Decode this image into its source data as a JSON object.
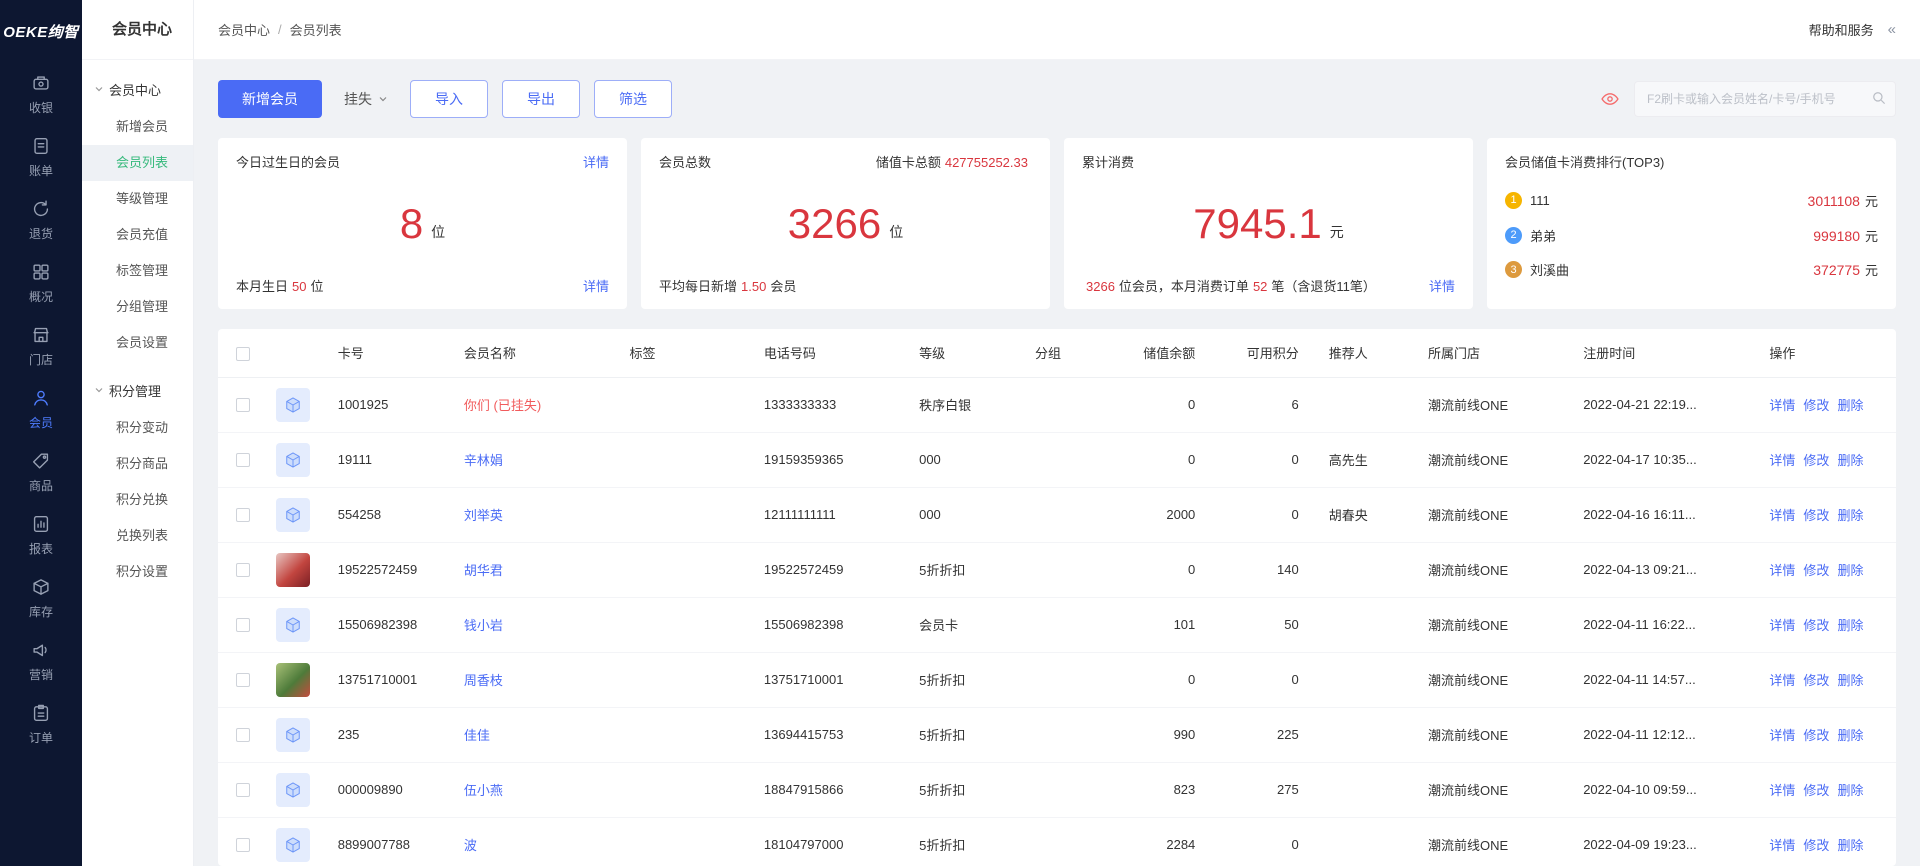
{
  "theme": {
    "primary": "#4a6bf5",
    "danger": "#d9363e",
    "green": "#36b97c",
    "railbg": "#0d1731",
    "link": "#4a6bf5",
    "eye": "#f56c6c",
    "medal1": "#f6b500",
    "medal2": "#4d9bfa",
    "medal3": "#dd9a3e"
  },
  "logo": {
    "text": "OEKE绚智"
  },
  "rail": {
    "items": [
      {
        "label": "收银",
        "icon": "cashier-icon"
      },
      {
        "label": "账单",
        "icon": "bill-icon"
      },
      {
        "label": "退货",
        "icon": "return-icon"
      },
      {
        "label": "概况",
        "icon": "overview-icon"
      },
      {
        "label": "门店",
        "icon": "store-icon"
      },
      {
        "label": "会员",
        "icon": "member-icon",
        "active": true
      },
      {
        "label": "商品",
        "icon": "product-icon"
      },
      {
        "label": "报表",
        "icon": "report-icon"
      },
      {
        "label": "库存",
        "icon": "inventory-icon"
      },
      {
        "label": "营销",
        "icon": "marketing-icon"
      },
      {
        "label": "订单",
        "icon": "order-icon"
      }
    ]
  },
  "submenu": {
    "title": "会员中心",
    "groups": [
      {
        "label": "会员中心",
        "items": [
          {
            "label": "新增会员"
          },
          {
            "label": "会员列表",
            "active": true
          },
          {
            "label": "等级管理"
          },
          {
            "label": "会员充值"
          },
          {
            "label": "标签管理"
          },
          {
            "label": "分组管理"
          },
          {
            "label": "会员设置"
          }
        ]
      },
      {
        "label": "积分管理",
        "items": [
          {
            "label": "积分变动"
          },
          {
            "label": "积分商品"
          },
          {
            "label": "积分兑换"
          },
          {
            "label": "兑换列表"
          },
          {
            "label": "积分设置"
          }
        ]
      }
    ]
  },
  "topbar": {
    "breadcrumb": [
      "会员中心",
      "会员列表"
    ],
    "separator": "/",
    "help": "帮助和服务",
    "collapse": "«"
  },
  "toolbar": {
    "add_button": "新增会员",
    "loss_button": "挂失",
    "import_button": "导入",
    "export_button": "导出",
    "filter_button": "筛选",
    "search_placeholder": "F2刷卡或输入会员姓名/卡号/手机号"
  },
  "stats": {
    "birthday_card": {
      "title": "今日过生日的会员",
      "detail_link": "详情",
      "value": "8",
      "unit": "位",
      "footer_prefix": "本月生日",
      "footer_value": "50",
      "footer_suffix": "位",
      "footer_link": "详情"
    },
    "total_card": {
      "title": "会员总数",
      "balance_label": "储值卡总额",
      "balance_value": "427755252.33",
      "value": "3266",
      "unit": "位",
      "footer_prefix": "平均每日新增",
      "footer_value": "1.50",
      "footer_suffix": "会员"
    },
    "consume_card": {
      "title": "累计消费",
      "value": "7945.1",
      "unit": "元",
      "footer_v1": "3266",
      "footer_p2": "位会员，本月消费订单",
      "footer_v2": "52",
      "footer_p3": "笔（含退货11笔）",
      "footer_link": "详情"
    },
    "rank_card": {
      "title": "会员储值卡消费排行(TOP3)",
      "unit": "元",
      "entries": [
        {
          "rank": "1",
          "name": "111",
          "amount": "3011108"
        },
        {
          "rank": "2",
          "name": "弟弟",
          "amount": "999180"
        },
        {
          "rank": "3",
          "name": "刘溪曲",
          "amount": "372775"
        }
      ]
    }
  },
  "table": {
    "columns": [
      "卡号",
      "会员名称",
      "标签",
      "电话号码",
      "等级",
      "分组",
      "储值余额",
      "可用积分",
      "推荐人",
      "所属门店",
      "注册时间",
      "操作"
    ],
    "actions": {
      "detail": "详情",
      "edit": "修改",
      "delete": "删除"
    },
    "rows": [
      {
        "card_no": "1001925",
        "name": "你们 (已挂失)",
        "tag": "",
        "phone": "1333333333",
        "level": "秩序白银",
        "group": "",
        "balance": "0",
        "points": "6",
        "referrer": "",
        "store": "潮流前线ONE",
        "reg_time": "2022-04-21 22:19...",
        "avatar": "cube-icon",
        "lost": true
      },
      {
        "card_no": "19111",
        "name": "辛林娟",
        "tag": "",
        "phone": "19159359365",
        "level": "000",
        "group": "",
        "balance": "0",
        "points": "0",
        "referrer": "高先生",
        "store": "潮流前线ONE",
        "reg_time": "2022-04-17 10:35...",
        "avatar": "cube-icon"
      },
      {
        "card_no": "554258",
        "name": "刘举英",
        "tag": "",
        "phone": "12111111111",
        "level": "000",
        "group": "",
        "balance": "2000",
        "points": "0",
        "referrer": "胡春央",
        "store": "潮流前线ONE",
        "reg_time": "2022-04-16 16:11...",
        "avatar": "cube-icon"
      },
      {
        "card_no": "19522572459",
        "name": "胡华君",
        "tag": "",
        "phone": "19522572459",
        "level": "5折折扣",
        "group": "",
        "balance": "0",
        "points": "140",
        "referrer": "",
        "store": "潮流前线ONE",
        "reg_time": "2022-04-13 09:21...",
        "avatar": "photo"
      },
      {
        "card_no": "15506982398",
        "name": "钱小岩",
        "tag": "",
        "phone": "15506982398",
        "level": "会员卡",
        "group": "",
        "balance": "101",
        "points": "50",
        "referrer": "",
        "store": "潮流前线ONE",
        "reg_time": "2022-04-11 16:22...",
        "avatar": "cube-icon"
      },
      {
        "card_no": "13751710001",
        "name": "周香枝",
        "tag": "",
        "phone": "13751710001",
        "level": "5折折扣",
        "group": "",
        "balance": "0",
        "points": "0",
        "referrer": "",
        "store": "潮流前线ONE",
        "reg_time": "2022-04-11 14:57...",
        "avatar": "photo"
      },
      {
        "card_no": "235",
        "name": "佳佳",
        "tag": "",
        "phone": "13694415753",
        "level": "5折折扣",
        "group": "",
        "balance": "990",
        "points": "225",
        "referrer": "",
        "store": "潮流前线ONE",
        "reg_time": "2022-04-11 12:12...",
        "avatar": "cube-icon"
      },
      {
        "card_no": "000009890",
        "name": "伍小燕",
        "tag": "",
        "phone": "18847915866",
        "level": "5折折扣",
        "group": "",
        "balance": "823",
        "points": "275",
        "referrer": "",
        "store": "潮流前线ONE",
        "reg_time": "2022-04-10 09:59...",
        "avatar": "cube-icon"
      },
      {
        "card_no": "8899007788",
        "name": "波",
        "tag": "",
        "phone": "18104797000",
        "level": "5折折扣",
        "group": "",
        "balance": "2284",
        "points": "0",
        "referrer": "",
        "store": "潮流前线ONE",
        "reg_time": "2022-04-09 19:23...",
        "avatar": "cube-icon"
      }
    ]
  }
}
